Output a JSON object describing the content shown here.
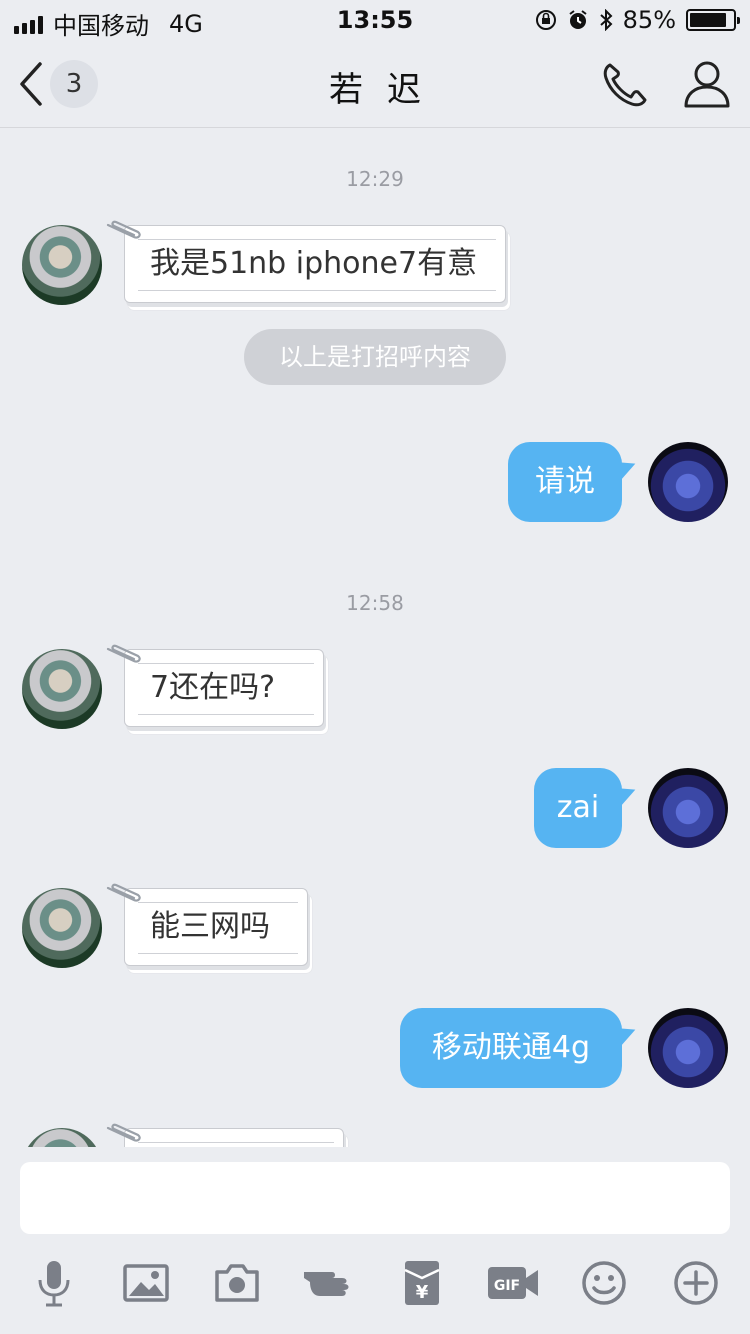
{
  "status": {
    "carrier": "中国移动",
    "network": "4G",
    "time": "13:55",
    "battery": "85%",
    "battery_level": 0.85
  },
  "nav": {
    "back_count": "3",
    "title": "若迟"
  },
  "icons": {
    "back": "chevron-left-icon",
    "phone": "phone-icon",
    "profile": "person-icon",
    "toolbar": [
      "microphone-icon",
      "image-icon",
      "camera-icon",
      "poke-hand-icon",
      "red-envelope-icon",
      "gif-icon",
      "emoji-icon",
      "plus-icon"
    ]
  },
  "toolbar": {
    "gif_label": "GIF",
    "red_envelope_label": "¥"
  },
  "colors": {
    "bubble_me": "#56b4f2",
    "background": "#ebedf1"
  },
  "messages": [
    {
      "type": "time",
      "text": "12:29"
    },
    {
      "type": "incoming",
      "text": "我是51nb iphone7有意"
    },
    {
      "type": "system",
      "text": "以上是打招呼内容"
    },
    {
      "type": "outgoing",
      "text": "请说"
    },
    {
      "type": "time",
      "text": "12:58"
    },
    {
      "type": "incoming",
      "text": "7还在吗?"
    },
    {
      "type": "outgoing",
      "text": "zai"
    },
    {
      "type": "incoming",
      "text": "能三网吗"
    },
    {
      "type": "outgoing",
      "text": "移动联通4g"
    },
    {
      "type": "incoming",
      "text": ""
    }
  ],
  "input": {
    "value": ""
  }
}
